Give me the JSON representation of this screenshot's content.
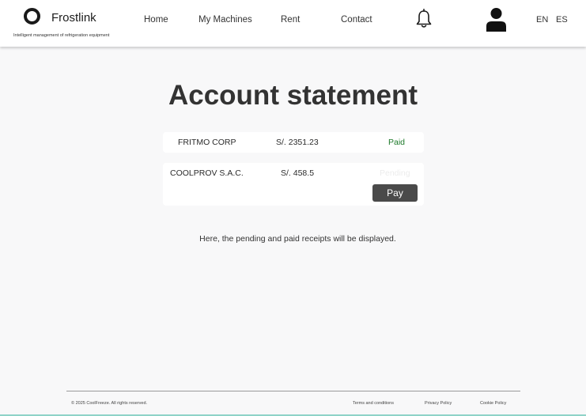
{
  "header": {
    "brand": "Frostlink",
    "tagline": "Intelligent management of refrigeration equipment",
    "nav": [
      "Home",
      "My Machines",
      "Rent",
      "Contact"
    ],
    "languages": [
      "EN",
      "ES"
    ],
    "icons": {
      "logo": "ring-logo-icon",
      "notifications": "bell-icon",
      "profile": "user-icon"
    }
  },
  "main": {
    "title": "Account statement",
    "statements": [
      {
        "company": "FRITMO CORP",
        "amount": "S/. 2351.23",
        "status": "Paid"
      },
      {
        "company": "COOLPROV S.A.C.",
        "amount": "S/. 458.5",
        "status": "Pending",
        "action": "Pay"
      }
    ],
    "info": "Here, the pending and paid receipts will be displayed."
  },
  "footer": {
    "copyright": "© 2025 CoolFreeze. All rights reserved.",
    "links": [
      "Terms and conditions",
      "Privacy Policy",
      "Cookie Policy"
    ]
  },
  "colors": {
    "paid": "#1e7a2b",
    "pending": "#ececec",
    "pay_button": "#4a4a4a",
    "page_background": "#f8f8f9"
  }
}
